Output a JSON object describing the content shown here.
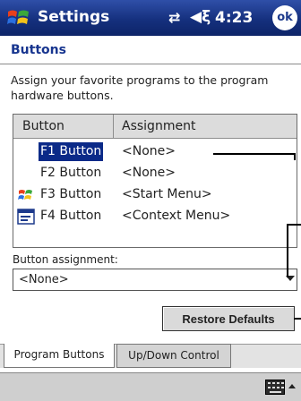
{
  "titlebar": {
    "title": "Settings",
    "connectivity_icon": "connectivity-icon",
    "volume_icon": "volume-icon",
    "time": "4:23",
    "ok_label": "ok"
  },
  "page": {
    "title": "Buttons",
    "description": "Assign your favorite programs to the program hardware buttons."
  },
  "list": {
    "columns": [
      "Button",
      "Assignment"
    ],
    "rows": [
      {
        "button": "F1 Button",
        "assignment": "<None>",
        "icon": "",
        "selected": true
      },
      {
        "button": "F2 Button",
        "assignment": "<None>",
        "icon": "",
        "selected": false
      },
      {
        "button": "F3 Button",
        "assignment": "<Start Menu>",
        "icon": "windows-flag-icon",
        "selected": false
      },
      {
        "button": "F4 Button",
        "assignment": "<Context Menu>",
        "icon": "context-menu-icon",
        "selected": false
      }
    ]
  },
  "assignment": {
    "label": "Button assignment:",
    "value": "<None>"
  },
  "restore_label": "Restore Defaults",
  "tabs": [
    {
      "label": "Program Buttons",
      "active": true
    },
    {
      "label": "Up/Down Control",
      "active": false
    }
  ],
  "bottombar": {
    "keyboard_icon": "keyboard-icon",
    "sip_icon": "up-arrow-icon"
  },
  "colors": {
    "titlebar": "#15307e",
    "selection": "#0b2a88",
    "page_title": "#17358f"
  }
}
